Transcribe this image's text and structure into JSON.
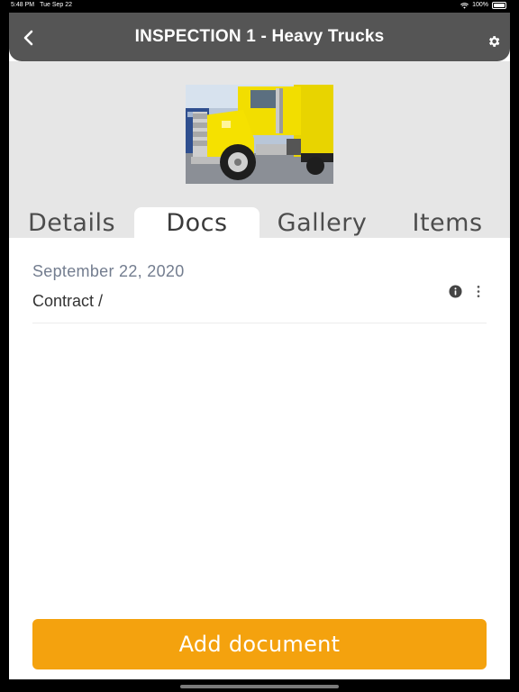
{
  "status_bar": {
    "time": "5:48 PM",
    "date": "Tue Sep 22",
    "battery": "100%",
    "icons": [
      "wifi-icon",
      "battery-icon"
    ]
  },
  "header": {
    "title": "INSPECTION 1 - Heavy Trucks",
    "back_icon": "chevron-left-icon",
    "settings_icon": "gear-icon",
    "background_color": "#555555"
  },
  "tabs": [
    {
      "label": "Details",
      "active": false
    },
    {
      "label": "Docs",
      "active": true
    },
    {
      "label": "Gallery",
      "active": false
    },
    {
      "label": "Items",
      "active": false
    }
  ],
  "documents": [
    {
      "date": "September 22, 2020",
      "name": "Contract /",
      "icons": [
        "info-icon",
        "more-vertical-icon"
      ]
    }
  ],
  "add_button": {
    "label": "Add document",
    "color": "#f4a20e"
  }
}
